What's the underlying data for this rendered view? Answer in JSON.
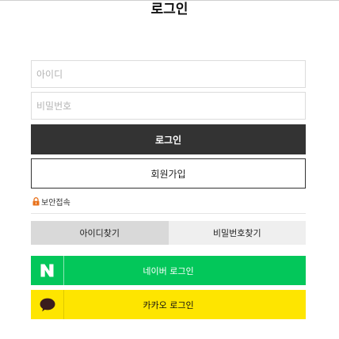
{
  "header": {
    "title": "로그인"
  },
  "form": {
    "id_placeholder": "아이디",
    "pw_placeholder": "비밀번호",
    "login_label": "로그인",
    "join_label": "회원가입",
    "secure_label": "보안접속"
  },
  "tabs": [
    {
      "label": "아이디찾기"
    },
    {
      "label": "비밀번호찾기"
    }
  ],
  "social": {
    "naver": {
      "label": "네이버 로그인",
      "icon": "naver-n-icon",
      "color": "#03c75a"
    },
    "kakao": {
      "label": "카카오 로그인",
      "icon": "kakao-speech-bubble-icon",
      "color": "#fee500"
    }
  },
  "colors": {
    "login_button": "#333333",
    "lock_icon": "#e8731e",
    "tab_active": "#d9d9d9",
    "tab_inactive": "#efefef"
  }
}
